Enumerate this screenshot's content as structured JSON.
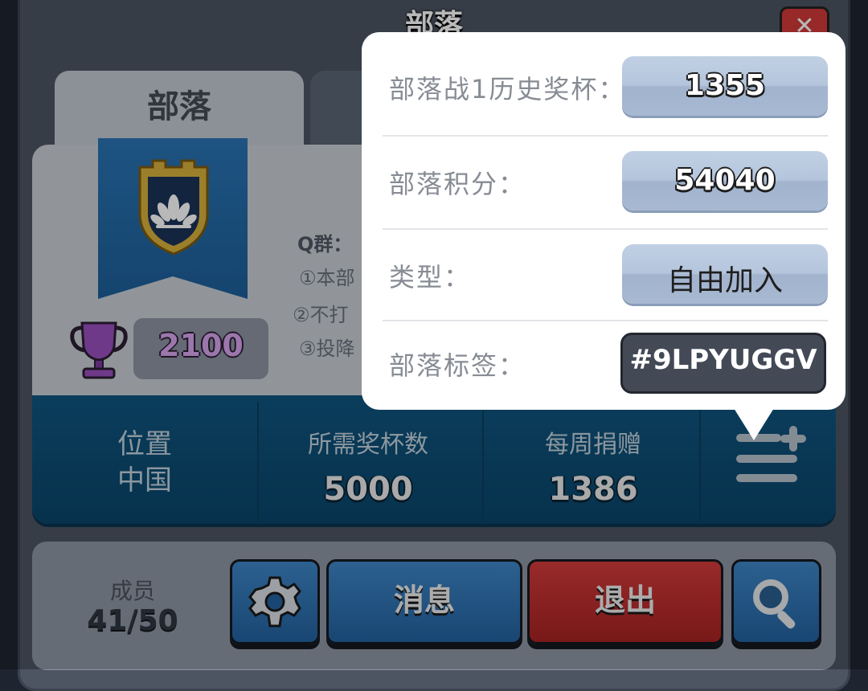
{
  "window": {
    "title": "部落"
  },
  "tabs": [
    {
      "label": "部落"
    }
  ],
  "clan": {
    "trophies": "2100",
    "description": [
      "Q群：",
      "①本部",
      "②不打",
      "③投降"
    ]
  },
  "stats": {
    "location_label": "位置",
    "location_value": "中国",
    "required_trophies_label": "所需奖杯数",
    "required_trophies_value": "5000",
    "weekly_donations_label": "每周捐赠",
    "weekly_donations_value": "1386"
  },
  "bottom": {
    "members_label": "成员",
    "members_value": "41/50",
    "message_label": "消息",
    "leave_label": "退出"
  },
  "popup": {
    "war_trophies_label": "部落战1历史奖杯：",
    "war_trophies_value": "1355",
    "clan_score_label": "部落积分：",
    "clan_score_value": "54040",
    "type_label": "类型：",
    "type_value": "自由加入",
    "tag_label": "部落标签：",
    "tag_value": "#9LPYUGGV"
  },
  "colors": {
    "banner": "#1d5f99",
    "stats_bar": "#0f5680",
    "leave_button": "#d33b3b",
    "blue_button": "#2e74b6",
    "trophy_purple": "#9a4fc0"
  },
  "icons": [
    "close-icon",
    "clan-shield-icon",
    "trophy-icon",
    "menu-add-icon",
    "gear-icon",
    "search-icon"
  ]
}
